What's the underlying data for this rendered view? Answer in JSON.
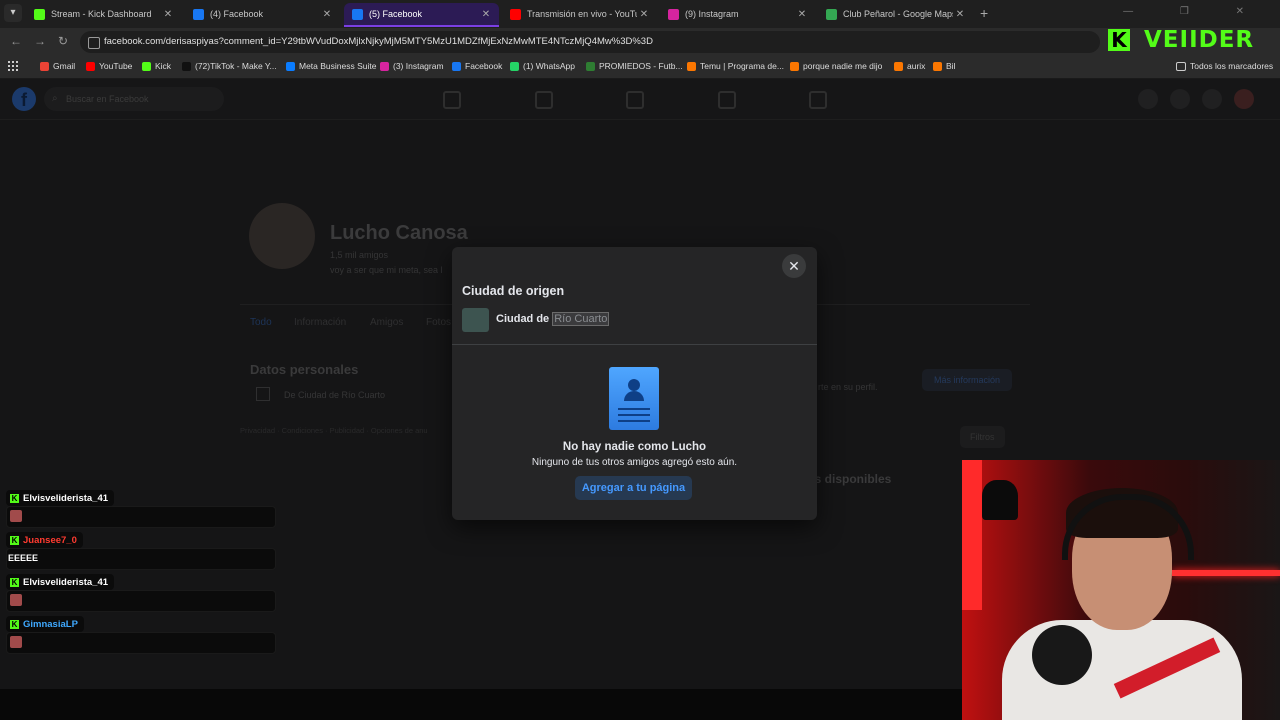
{
  "browser": {
    "tabs": [
      {
        "title": "Stream - Kick Dashboard",
        "fav_color": "#53fc18",
        "active": false
      },
      {
        "title": "(4) Facebook",
        "fav_color": "#1877f2",
        "active": false
      },
      {
        "title": "(5) Facebook",
        "fav_color": "#1877f2",
        "active": true
      },
      {
        "title": "Transmisión en vivo - YouTube",
        "fav_color": "#ff0000",
        "active": false
      },
      {
        "title": "(9) Instagram",
        "fav_color": "#d6249f",
        "active": false
      },
      {
        "title": "Club Peñarol - Google Maps",
        "fav_color": "#34a853",
        "active": false
      }
    ],
    "new_tab": "+",
    "url": "facebook.com/derisaspiyas?comment_id=Y29tbWVudDoxMjlxNjkyMjM5MTY5MzU1MDZfMjExNzMwMTE4NTczMjQ4Mw%3D%3D",
    "bookmarks": [
      {
        "label": "Gmail",
        "color": "#ea4335"
      },
      {
        "label": "YouTube",
        "color": "#ff0000"
      },
      {
        "label": "Kick",
        "color": "#53fc18"
      },
      {
        "label": "(72)TikTok - Make Y...",
        "color": "#111111"
      },
      {
        "label": "Meta Business Suite",
        "color": "#0a7cff"
      },
      {
        "label": "(3) Instagram",
        "color": "#d6249f"
      },
      {
        "label": "Facebook",
        "color": "#1877f2"
      },
      {
        "label": "(1) WhatsApp",
        "color": "#25d366"
      },
      {
        "label": "PROMIEDOS - Futb...",
        "color": "#2e7d32"
      },
      {
        "label": "Temu | Programa de...",
        "color": "#fb7701"
      },
      {
        "label": "porque nadie me dijo",
        "color": "#fb7701"
      },
      {
        "label": "aurix",
        "color": "#fb7701"
      },
      {
        "label": "Bil",
        "color": "#fb7701"
      }
    ],
    "all_bookmarks": "Todos los marcadores"
  },
  "overlay_logo": {
    "k": "K",
    "word": "VEIIDER"
  },
  "facebook": {
    "search_placeholder": "Buscar en Facebook",
    "profile_name": "Lucho Canosa",
    "friends": "1,5 mil amigos",
    "bio": "voy a ser que mi meta, sea l",
    "tabs": [
      "Todo",
      "Información",
      "Amigos",
      "Fotos"
    ],
    "personal_data_title": "Datos personales",
    "personal_data_row": "De Ciudad de Río Cuarto",
    "footer": "Privacidad · Condiciones · Publicidad · Opciones de anu",
    "right_text": "rte en su perfil.",
    "more_info": "Más información",
    "filters": "Filtros",
    "available": "es disponibles"
  },
  "modal": {
    "title": "Ciudad de origen",
    "city_prefix": "Ciudad de",
    "city_name": "Río Cuarto",
    "empty_title": "No hay nadie como Lucho",
    "empty_subtitle": "Ninguno de tus otros amigos agregó esto aún.",
    "add_button": "Agregar a tu página",
    "close": "✕"
  },
  "chat": [
    {
      "user": "Elvisveliderista_41",
      "user_color": "#ffffff",
      "type": "emote",
      "text": ""
    },
    {
      "user": "Juansee7_0",
      "user_color": "#ff3b30",
      "type": "text",
      "text": "EEEEE"
    },
    {
      "user": "Elvisveliderista_41",
      "user_color": "#ffffff",
      "type": "emote",
      "text": ""
    },
    {
      "user": "GimnasiaLP",
      "user_color": "#3fa9ff",
      "type": "emote",
      "text": ""
    }
  ]
}
